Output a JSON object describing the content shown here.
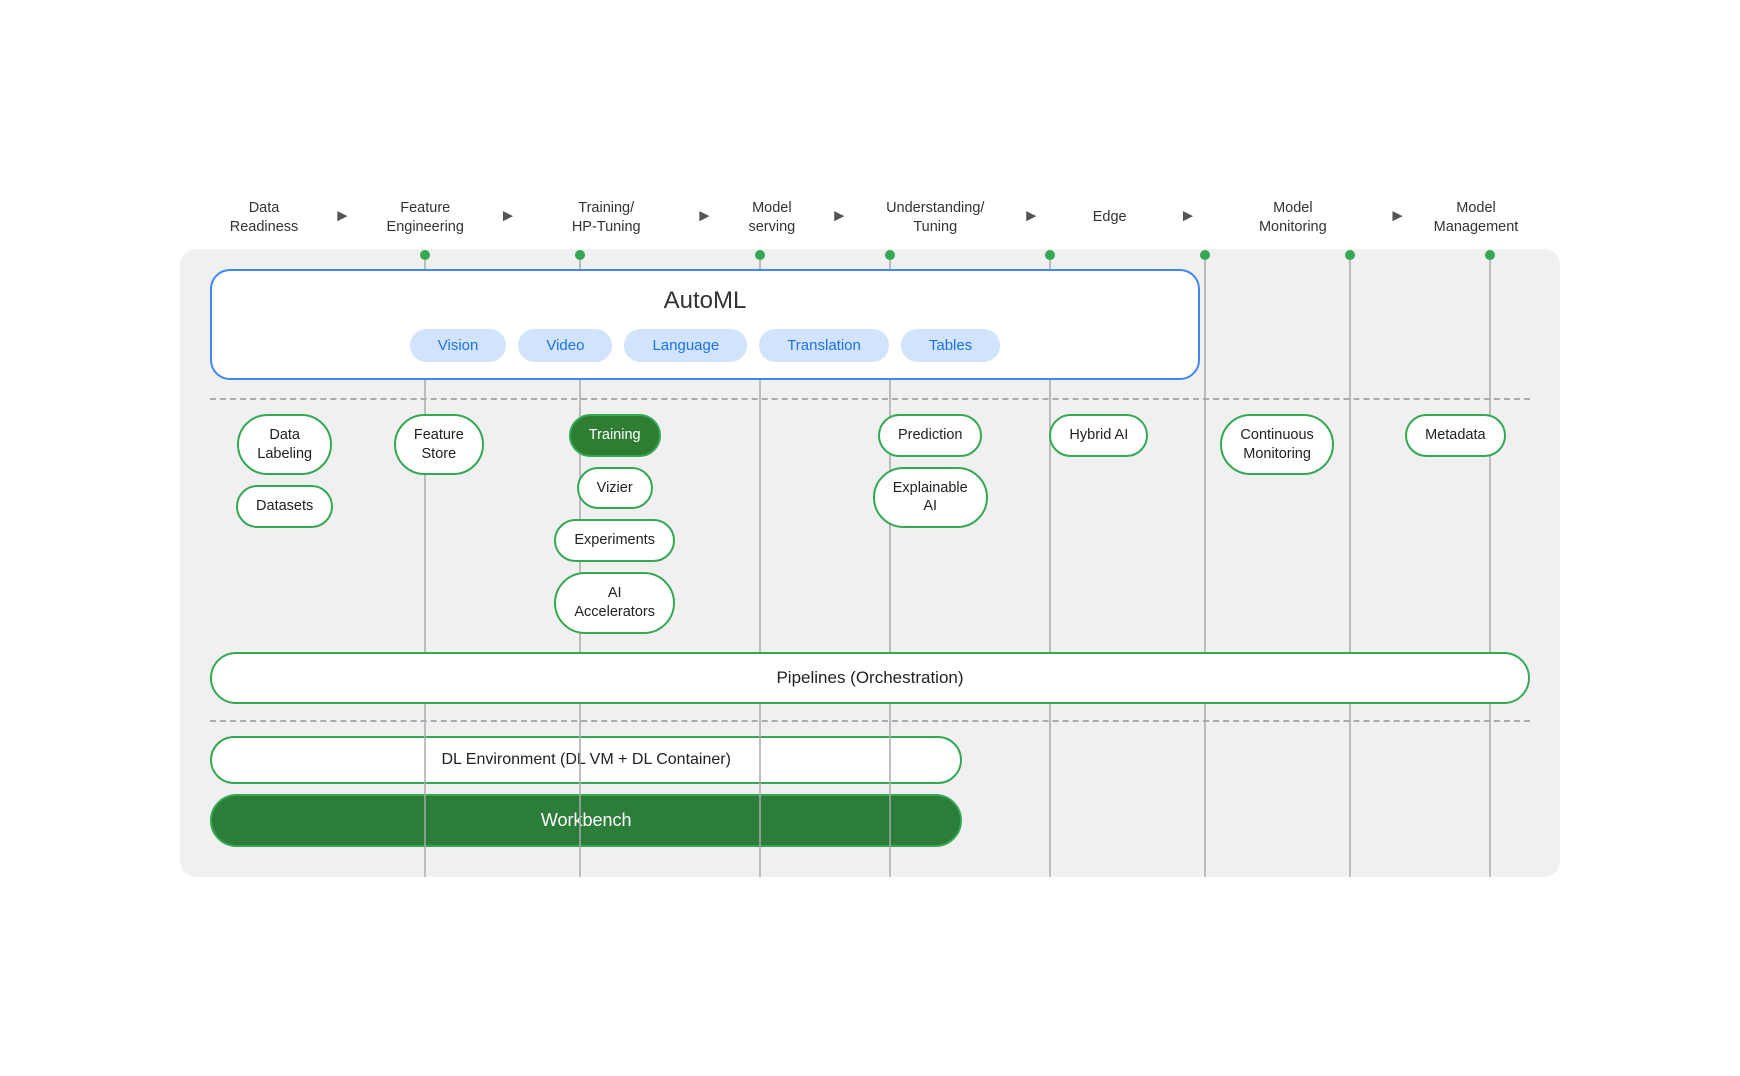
{
  "pipeline": {
    "steps": [
      {
        "label": "Data\nReadiness"
      },
      {
        "label": "Feature\nEngineering"
      },
      {
        "label": "Training/\nHP-Tuning"
      },
      {
        "label": "Model\nserving"
      },
      {
        "label": "Understanding/\nTuning"
      },
      {
        "label": "Edge"
      },
      {
        "label": "Model\nMonitoring"
      },
      {
        "label": "Model\nManagement"
      }
    ]
  },
  "automl": {
    "title": "AutoML",
    "pills": [
      "Vision",
      "Video",
      "Language",
      "Translation",
      "Tables"
    ]
  },
  "components": {
    "col1": {
      "items": [
        "Data\nLabeling",
        "Datasets"
      ]
    },
    "col2": {
      "items": [
        "Feature\nStore"
      ]
    },
    "col3": {
      "items": [
        "Training",
        "Vizier",
        "Experiments",
        "AI\nAccelerators"
      ]
    },
    "col4": {
      "items": []
    },
    "col5": {
      "items": [
        "Prediction",
        "Explainable\nAI"
      ]
    },
    "col6": {
      "items": [
        "Hybrid AI"
      ]
    },
    "col7": {
      "items": [
        "Continuous\nMonitoring"
      ]
    },
    "col8": {
      "items": [
        "Metadata"
      ]
    }
  },
  "pipelines": {
    "label": "Pipelines (Orchestration)"
  },
  "dl": {
    "env_label": "DL Environment (DL VM + DL Container)",
    "workbench_label": "Workbench"
  },
  "colors": {
    "green_border": "#34a853",
    "green_filled": "#2e7d32",
    "blue_border": "#4285F4",
    "blue_pill_bg": "#d2e3fc",
    "blue_pill_text": "#1a73e8",
    "dot_green": "#34a853"
  }
}
